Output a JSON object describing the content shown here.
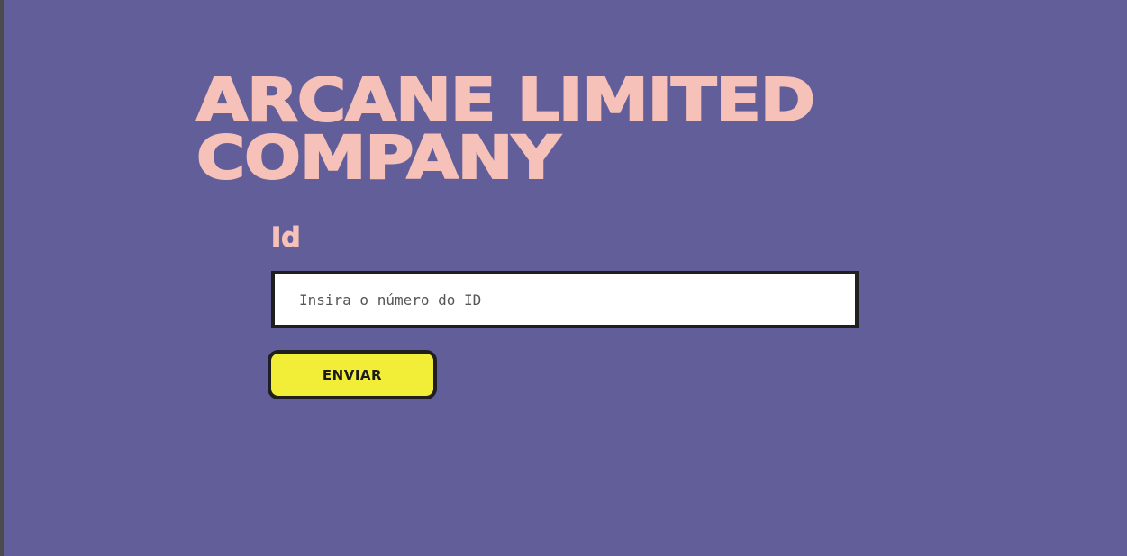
{
  "header": {
    "title": "ARCANE LIMITED COMPANY"
  },
  "form": {
    "id_label": "Id",
    "id_input": {
      "value": "",
      "placeholder": "Insira o número do ID"
    },
    "submit_label": "ENVIAR"
  },
  "colors": {
    "background": "#615e9a",
    "title": "#f6c1b9",
    "button": "#f2ed36",
    "border": "#1f1f1f"
  }
}
